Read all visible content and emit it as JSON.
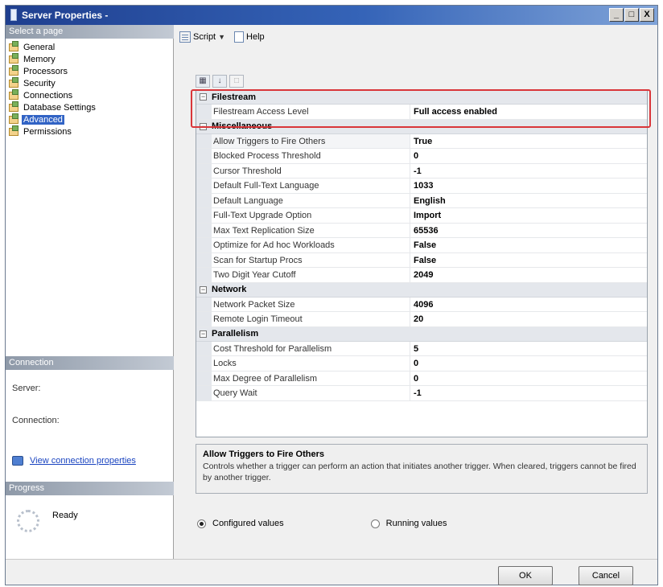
{
  "window": {
    "title": "Server Properties -"
  },
  "title_buttons": [
    "_",
    "□",
    "X"
  ],
  "left_pane": {
    "select_page_header": "Select a page",
    "pages": [
      {
        "label": "General",
        "icon": "page-icon"
      },
      {
        "label": "Memory",
        "icon": "page-icon"
      },
      {
        "label": "Processors",
        "icon": "page-icon"
      },
      {
        "label": "Security",
        "icon": "page-icon"
      },
      {
        "label": "Connections",
        "icon": "page-icon"
      },
      {
        "label": "Database Settings",
        "icon": "page-icon"
      },
      {
        "label": "Advanced",
        "icon": "page-icon",
        "selected": true
      },
      {
        "label": "Permissions",
        "icon": "page-icon"
      }
    ],
    "connection_header": "Connection",
    "server_label": "Server:",
    "connection_label": "Connection:",
    "view_connection_link": "View connection properties",
    "progress_header": "Progress",
    "progress_status": "Ready"
  },
  "toolbar": {
    "script_label": "Script",
    "help_label": "Help"
  },
  "property_grid": {
    "categories": [
      {
        "name": "Filestream",
        "rows": [
          {
            "name": "Filestream Access Level",
            "value": "Full access enabled"
          }
        ]
      },
      {
        "name": "Miscellaneous",
        "rows": [
          {
            "name": "Allow Triggers to Fire Others",
            "value": "True",
            "selected": true
          },
          {
            "name": "Blocked Process Threshold",
            "value": "0"
          },
          {
            "name": "Cursor Threshold",
            "value": "-1"
          },
          {
            "name": "Default Full-Text Language",
            "value": "1033"
          },
          {
            "name": "Default Language",
            "value": "English"
          },
          {
            "name": "Full-Text Upgrade Option",
            "value": "Import"
          },
          {
            "name": "Max Text Replication Size",
            "value": "65536"
          },
          {
            "name": "Optimize for Ad hoc Workloads",
            "value": "False"
          },
          {
            "name": "Scan for Startup Procs",
            "value": "False"
          },
          {
            "name": "Two Digit Year Cutoff",
            "value": "2049"
          }
        ]
      },
      {
        "name": "Network",
        "rows": [
          {
            "name": "Network Packet Size",
            "value": "4096"
          },
          {
            "name": "Remote Login Timeout",
            "value": "20"
          }
        ]
      },
      {
        "name": "Parallelism",
        "rows": [
          {
            "name": "Cost Threshold for Parallelism",
            "value": "5"
          },
          {
            "name": "Locks",
            "value": "0"
          },
          {
            "name": "Max Degree of Parallelism",
            "value": "0"
          },
          {
            "name": "Query Wait",
            "value": "-1"
          }
        ]
      }
    ]
  },
  "description": {
    "title": "Allow Triggers to Fire Others",
    "text": "Controls whether a trigger can perform an action that initiates another trigger. When cleared, triggers cannot be fired by another trigger."
  },
  "radios": {
    "configured_label": "Configured values",
    "running_label": "Running values",
    "selected": "configured"
  },
  "buttons": {
    "ok": "OK",
    "cancel": "Cancel"
  },
  "colors": {
    "highlight_border": "#d9363a",
    "selected_page": "#3163c5",
    "title_bar": "#1f3f8f"
  }
}
